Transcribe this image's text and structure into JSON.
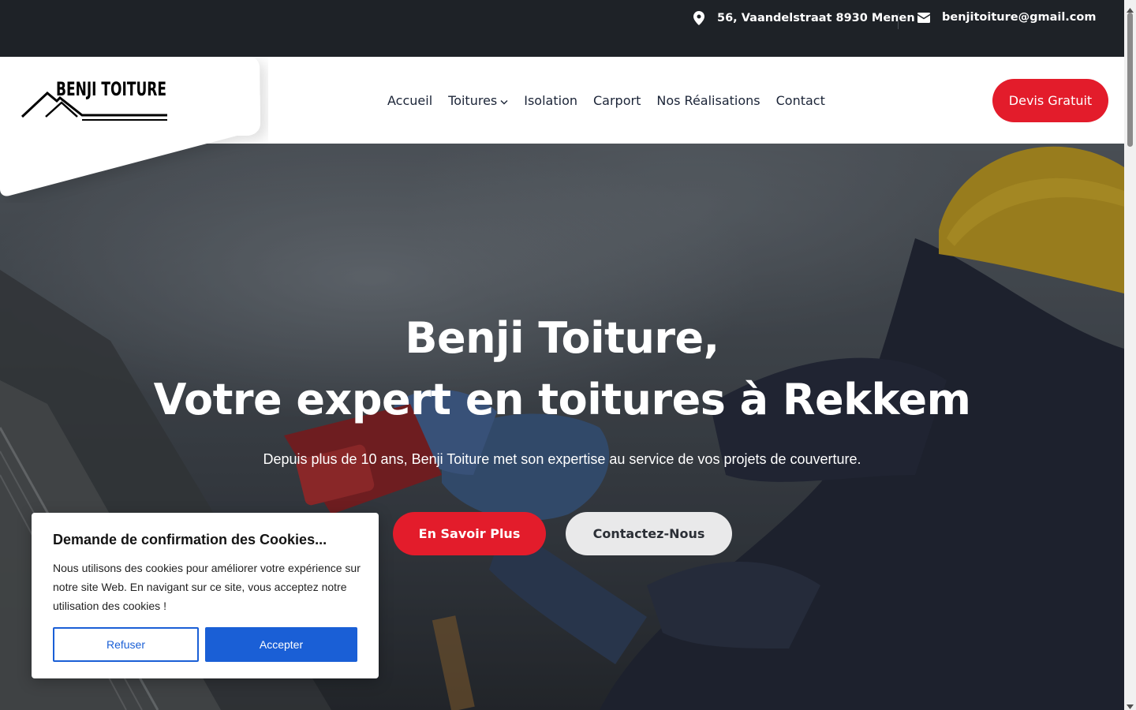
{
  "topbar": {
    "address": "56, Vaandelstraat 8930 Menen",
    "email": "benjitoiture@gmail.com"
  },
  "header": {
    "logo_text": "BENJI TOITURE",
    "nav": [
      {
        "label": "Accueil"
      },
      {
        "label": "Toitures"
      },
      {
        "label": "Isolation"
      },
      {
        "label": "Carport"
      },
      {
        "label": "Nos Réalisations"
      },
      {
        "label": "Contact"
      }
    ],
    "cta_label": "Devis Gratuit"
  },
  "hero": {
    "title_line1": "Benji Toiture,",
    "title_line2": "Votre expert en toitures à Rekkem",
    "subtitle": "Depuis plus de 10 ans, Benji Toiture met son expertise au service de vos projets de couverture.",
    "primary_button": "En Savoir Plus",
    "secondary_button": "Contactez-Nous"
  },
  "cookie_banner": {
    "title": "Demande de confirmation des Cookies...",
    "text": "Nous utilisons des cookies pour améliorer votre expérience sur notre site Web. En navigant sur ce site, vous acceptez notre utilisation des cookies !",
    "refuse_label": "Refuser",
    "accept_label": "Accepter"
  },
  "colors": {
    "accent_red": "#e31c2b",
    "cookie_blue": "#1a5fd6",
    "topbar_bg": "#1e2227"
  },
  "icons": {
    "address": "map-pin-icon",
    "email": "envelope-icon",
    "dropdown": "chevron-down-icon"
  }
}
